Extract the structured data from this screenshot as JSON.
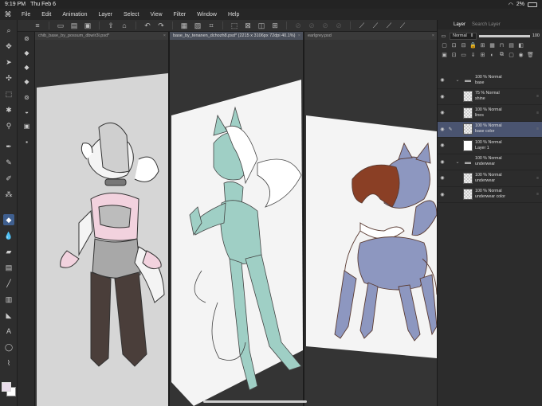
{
  "status": {
    "time": "9:19 PM",
    "date": "Thu Feb 6",
    "battery": "2%"
  },
  "menu": {
    "items": [
      "File",
      "Edit",
      "Animation",
      "Layer",
      "Select",
      "View",
      "Filter",
      "Window",
      "Help"
    ]
  },
  "tabs": [
    {
      "label": "chib_base_by_possum_dbwir3l.psd*",
      "close": "×"
    },
    {
      "label": "base_by_tenanen_dchozh8.psd* (2215 x 3106px 72dpi 40.1%)",
      "close": "×"
    },
    {
      "label": "earlgrey.psd",
      "close": "×"
    }
  ],
  "panel": {
    "tabs": [
      "Layer",
      "Search Layer"
    ],
    "blend_mode": "Normal",
    "opacity": "100"
  },
  "layers": [
    {
      "line1": "100 % Normal",
      "line2": "base",
      "type": "folder",
      "selected": false
    },
    {
      "line1": "75 % Normal",
      "line2": "shine",
      "type": "raster",
      "selected": false
    },
    {
      "line1": "100 % Normal",
      "line2": "lines",
      "type": "raster",
      "selected": false
    },
    {
      "line1": "100 % Normal",
      "line2": "base color",
      "type": "raster",
      "selected": true
    },
    {
      "line1": "100 % Normal",
      "line2": "Layer 1",
      "type": "paper",
      "selected": false
    },
    {
      "line1": "100 % Normal",
      "line2": "underwear",
      "type": "folder",
      "selected": false
    },
    {
      "line1": "100 % Normal",
      "line2": "underwear",
      "type": "raster",
      "selected": false
    },
    {
      "line1": "100 % Normal",
      "line2": "underwear color",
      "type": "raster",
      "selected": false
    }
  ],
  "colors": {
    "accent": "#3f5f8f",
    "main_color": "#e9dcea",
    "sub_color": "#ffffff",
    "selected_layer": "#4a5470"
  }
}
